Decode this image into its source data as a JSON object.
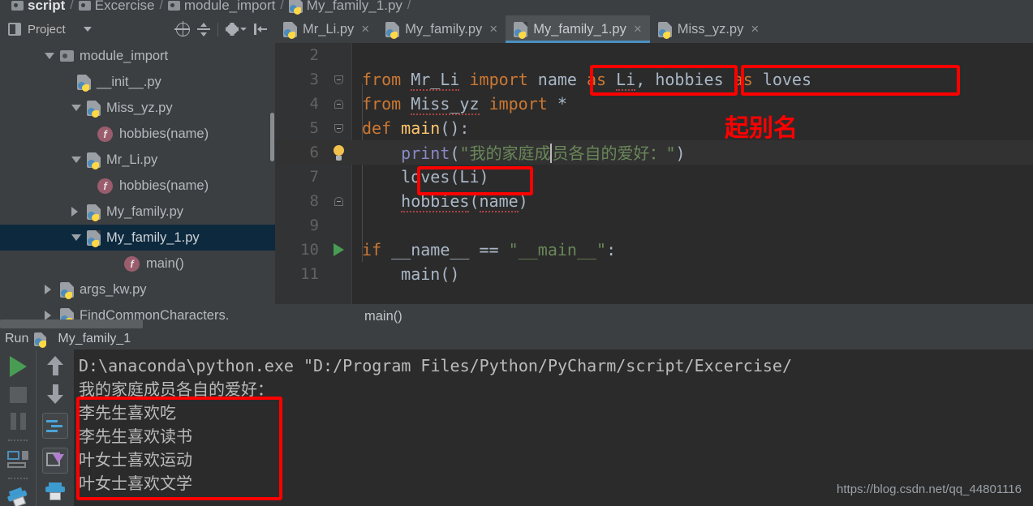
{
  "breadcrumb": {
    "items": [
      {
        "label": "script",
        "icon": "folder-icon",
        "bold": true
      },
      {
        "label": "Excercise",
        "icon": "folder-icon",
        "bold": false
      },
      {
        "label": "module_import",
        "icon": "folder-icon",
        "bold": false
      },
      {
        "label": "My_family_1.py",
        "icon": "python-file-icon",
        "bold": false
      }
    ]
  },
  "project_panel": {
    "title": "Project",
    "tools": [
      "locate-icon",
      "collapse-all-icon",
      "settings-gear-icon",
      "hide-panel-icon"
    ],
    "tree": [
      {
        "label": "module_import",
        "icon": "folder-icon",
        "state": "open",
        "indent": 1,
        "selected": false
      },
      {
        "label": "__init__.py",
        "icon": "python-file-icon",
        "state": "leaf",
        "indent": 2,
        "selected": false
      },
      {
        "label": "Miss_yz.py",
        "icon": "python-file-icon",
        "state": "open",
        "indent": 2,
        "selected": false
      },
      {
        "label": "hobbies(name)",
        "icon": "function-icon",
        "state": "leaf",
        "indent": 3,
        "selected": false
      },
      {
        "label": "Mr_Li.py",
        "icon": "python-file-icon",
        "state": "open",
        "indent": 2,
        "selected": false
      },
      {
        "label": "hobbies(name)",
        "icon": "function-icon",
        "state": "leaf",
        "indent": 3,
        "selected": false
      },
      {
        "label": "My_family.py",
        "icon": "python-file-icon",
        "state": "closed",
        "indent": 2,
        "selected": false
      },
      {
        "label": "My_family_1.py",
        "icon": "python-file-icon",
        "state": "open",
        "indent": 2,
        "selected": true
      },
      {
        "label": "main()",
        "icon": "function-icon",
        "state": "leaf",
        "indent": 3,
        "selected": false
      },
      {
        "label": "args_kw.py",
        "icon": "python-file-icon",
        "state": "closed",
        "indent": 1,
        "selected": false
      },
      {
        "label": "FindCommonCharacters.",
        "icon": "python-file-icon",
        "state": "closed",
        "indent": 1,
        "selected": false
      }
    ]
  },
  "editor": {
    "tabs": [
      {
        "label": "Mr_Li.py",
        "active": false,
        "close": "×"
      },
      {
        "label": "My_family.py",
        "active": false,
        "close": "×"
      },
      {
        "label": "My_family_1.py",
        "active": true,
        "close": "×"
      },
      {
        "label": "Miss_yz.py",
        "active": false,
        "close": "×"
      }
    ],
    "lines": [
      {
        "no": "2",
        "code": ""
      },
      {
        "no": "3",
        "code": "from Mr_Li import name as Li, hobbies as loves"
      },
      {
        "no": "4",
        "code": "from Miss_yz import *"
      },
      {
        "no": "5",
        "code": "def main():"
      },
      {
        "no": "6",
        "code": "    print(\"我的家庭成员各自的爱好：\")"
      },
      {
        "no": "7",
        "code": "    loves(Li)"
      },
      {
        "no": "8",
        "code": "    hobbies(name)"
      },
      {
        "no": "9",
        "code": ""
      },
      {
        "no": "10",
        "code": "if __name__ == \"__main__\":"
      },
      {
        "no": "11",
        "code": "    main()"
      }
    ],
    "breadcrumb": "main()"
  },
  "annotations": {
    "note_text": "起别名",
    "color": "#ff0000",
    "boxes": [
      "name as Li",
      "hobbies as loves",
      "loves(Li)",
      "console-output-lines"
    ]
  },
  "run_panel": {
    "run_label": "Run",
    "config_name": "My_family_1",
    "toolbar_left": [
      "run-icon",
      "stop-icon",
      "pause-icon",
      "layout-icon",
      "print-icon"
    ],
    "toolbar_right": [
      "up-arrow-icon",
      "down-arrow-icon",
      "soft-wrap-icon",
      "export-icon"
    ],
    "console": [
      "D:\\anaconda\\python.exe \"D:/Program Files/Python/PyCharm/script/Excercise/",
      "我的家庭成员各自的爱好：",
      "李先生喜欢吃",
      "李先生喜欢读书",
      "叶女士喜欢运动",
      "叶女士喜欢文学"
    ]
  },
  "watermark": "https://blog.csdn.net/qq_44801116"
}
